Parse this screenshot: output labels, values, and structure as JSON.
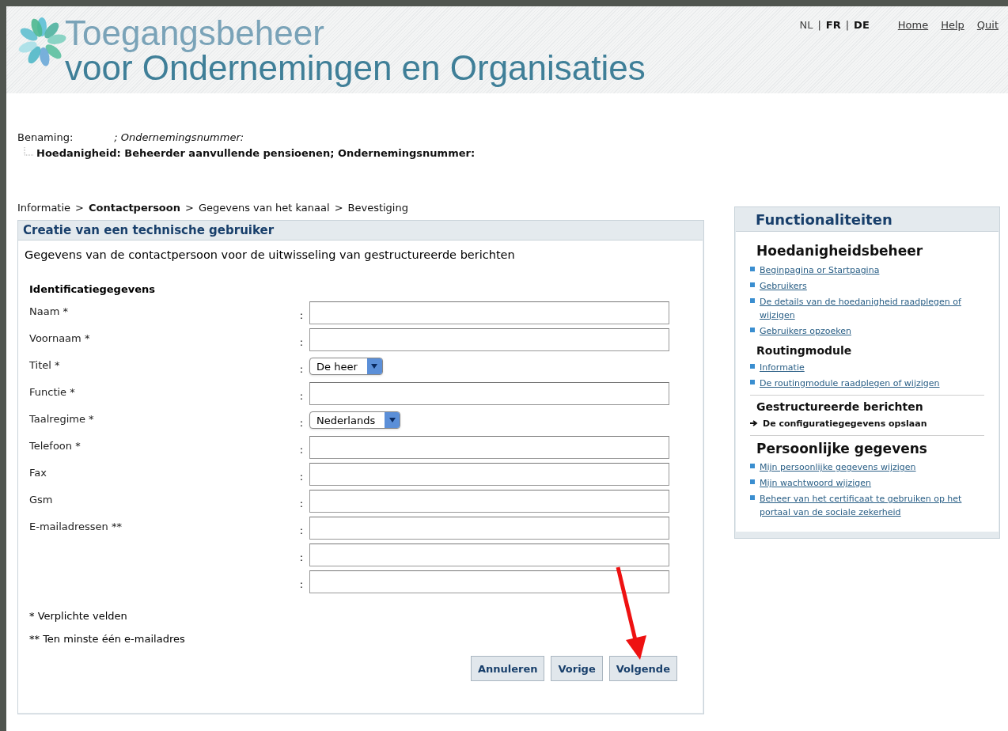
{
  "header": {
    "title_line_1": "Toegangsbeheer",
    "title_line_2": "voor Ondernemingen en Organisaties",
    "languages": [
      {
        "label": "NL",
        "selected": true
      },
      {
        "label": "FR",
        "selected": false
      },
      {
        "label": "DE",
        "selected": false
      }
    ],
    "separator": "|",
    "links": [
      "Home",
      "Help",
      "Quit"
    ]
  },
  "identity": {
    "label": "Benaming:",
    "company_number": "; Ondernemingsnummer:",
    "capacity": "Hoedanigheid: Beheerder aanvullende pensioenen; Ondernemingsnummer:"
  },
  "breadcrumb": {
    "separator": ">",
    "steps": [
      {
        "label": "Informatie",
        "selected": false
      },
      {
        "label": "Contactpersoon",
        "selected": true
      },
      {
        "label": "Gegevens van het kanaal",
        "selected": false
      },
      {
        "label": "Bevestiging",
        "selected": false
      }
    ]
  },
  "form": {
    "title": "Creatie van een technische gebruiker",
    "intro": "Gegevens van de contactpersoon voor de uitwisseling van gestructureerde berichten",
    "section": "Identificatiegegevens",
    "colon": ":",
    "fields": [
      {
        "kind": "text",
        "label": "Naam *"
      },
      {
        "kind": "text",
        "label": "Voornaam *"
      },
      {
        "kind": "select",
        "label": "Titel *",
        "value": "De heer"
      },
      {
        "kind": "text",
        "label": "Functie *"
      },
      {
        "kind": "select",
        "label": "Taalregime *",
        "value": "Nederlands"
      },
      {
        "kind": "text",
        "label": "Telefoon *"
      },
      {
        "kind": "text",
        "label": "Fax"
      },
      {
        "kind": "text",
        "label": "Gsm"
      },
      {
        "kind": "text",
        "label": "E-mailadressen **"
      },
      {
        "kind": "text"
      },
      {
        "kind": "text"
      }
    ],
    "notes": [
      "* Verplichte velden",
      "** Ten minste één e-mailadres"
    ],
    "buttons": [
      "Annuleren",
      "Vorige",
      "Volgende"
    ]
  },
  "sidebar": {
    "title": "Functionaliteiten",
    "sections": [
      {
        "title": "Hoedanigheidsbeheer",
        "large": true,
        "items": [
          {
            "kind": "link",
            "label": "Beginpagina or Startpagina"
          },
          {
            "kind": "link",
            "label": "Gebruikers"
          },
          {
            "kind": "link",
            "label": "De details van de hoedanigheid raadplegen of wijzigen"
          },
          {
            "kind": "link",
            "label": "Gebruikers opzoeken"
          }
        ]
      },
      {
        "title": "Routingmodule",
        "large": false,
        "items": [
          {
            "kind": "link",
            "label": "Informatie"
          },
          {
            "kind": "link",
            "label": "De routingmodule raadplegen of wijzigen"
          }
        ]
      },
      {
        "title": "Gestructureerde berichten",
        "large": false,
        "items": [
          {
            "kind": "current",
            "label": "De configuratiegegevens opslaan"
          }
        ]
      },
      {
        "title": "Persoonlijke gegevens",
        "large": true,
        "items": [
          {
            "kind": "link",
            "label": "Mijn persoonlijke gegevens wijzigen"
          },
          {
            "kind": "link",
            "label": "Mijn wachtwoord wijzigen"
          },
          {
            "kind": "link",
            "label": "Beheer van het certificaat te gebruiken op het portaal van de sociale zekerheid"
          }
        ]
      }
    ]
  }
}
